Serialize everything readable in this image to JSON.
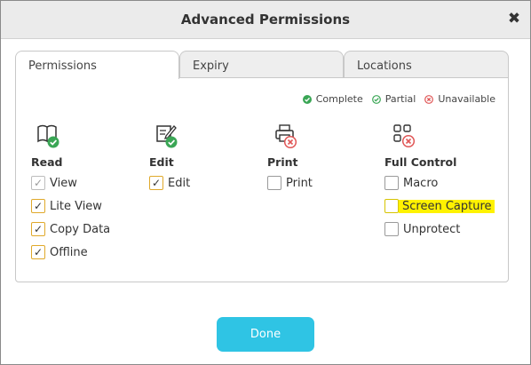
{
  "dialog": {
    "title": "Advanced Permissions",
    "close_symbol": "✖"
  },
  "tabs": [
    {
      "label": "Permissions",
      "active": true
    },
    {
      "label": "Expiry",
      "active": false
    },
    {
      "label": "Locations",
      "active": false
    }
  ],
  "legend": {
    "complete": "Complete",
    "partial": "Partial",
    "unavailable": "Unavailable"
  },
  "columns": {
    "read": {
      "heading": "Read",
      "icon": "book-icon",
      "status": "complete",
      "options": [
        {
          "label": "View",
          "checked": true,
          "disabled": true
        },
        {
          "label": "Lite View",
          "checked": true
        },
        {
          "label": "Copy Data",
          "checked": true
        },
        {
          "label": "Offline",
          "checked": true
        }
      ]
    },
    "edit": {
      "heading": "Edit",
      "icon": "edit-icon",
      "status": "complete",
      "options": [
        {
          "label": "Edit",
          "checked": true
        }
      ]
    },
    "print": {
      "heading": "Print",
      "icon": "printer-icon",
      "status": "unavailable",
      "options": [
        {
          "label": "Print",
          "checked": false
        }
      ]
    },
    "full_control": {
      "heading": "Full Control",
      "icon": "grid-icon",
      "status": "unavailable",
      "options": [
        {
          "label": "Macro",
          "checked": false
        },
        {
          "label": "Screen Capture",
          "checked": false,
          "highlighted": true
        },
        {
          "label": "Unprotect",
          "checked": false
        }
      ]
    }
  },
  "check_mark": "✓",
  "done_label": "Done",
  "colors": {
    "accent": "#2fc4e4",
    "complete": "#3aa655",
    "unavailable": "#e05656",
    "checkbox_checked_border": "#e0a92b",
    "highlight": "#fff200"
  }
}
